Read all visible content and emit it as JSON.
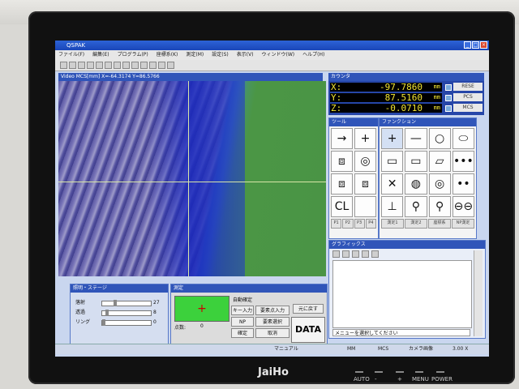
{
  "device": {
    "brand": "JaiHo",
    "buttons": [
      "AUTO",
      "-",
      "+",
      "MENU",
      "POWER"
    ]
  },
  "window": {
    "title": "QSPAK",
    "menu": [
      "ファイル(F)",
      "編集(E)",
      "プログラム(P)",
      "座標系(K)",
      "測定(M)",
      "設定(S)",
      "表示(V)",
      "ウィンドウ(W)",
      "ヘルプ(H)"
    ]
  },
  "video": {
    "title": "Video   MCS[mm] X=-64.3174 Y=86.5766"
  },
  "counter": {
    "title": "カウンタ",
    "rows": [
      {
        "axis": "X:",
        "value": "-97.7860",
        "unit": "mm",
        "label": "RESE"
      },
      {
        "axis": "Y:",
        "value": "87.5160",
        "unit": "mm",
        "label": "PCS"
      },
      {
        "axis": "Z:",
        "value": "-0.0710",
        "unit": "mm",
        "label": "MCS"
      }
    ]
  },
  "tools": {
    "title": "ツール",
    "items": [
      "→",
      "+",
      "⧈",
      "◎",
      "⧈",
      "⧈",
      "CL",
      ""
    ],
    "tabs": [
      "P1",
      "P2",
      "P3",
      "P4"
    ]
  },
  "functions": {
    "title": "ファンクション",
    "items": [
      "+",
      "—",
      "○",
      "⬭",
      "▭",
      "▭",
      "▱",
      "•••",
      "✕",
      "◍",
      "◎",
      "••",
      "⊥",
      "⚲",
      "⚲",
      "⊖⊖"
    ],
    "tabs": [
      "測定1",
      "測定2",
      "座標系",
      "NP測定"
    ]
  },
  "graphics": {
    "title": "グラフィックス",
    "status": "メニューを選択してください"
  },
  "lighting": {
    "title": "照明・ステージ",
    "rows": [
      {
        "label": "落射",
        "value": "27"
      },
      {
        "label": "透過",
        "value": "8"
      },
      {
        "label": "リング",
        "value": "0"
      }
    ],
    "unit": "%"
  },
  "measure": {
    "title": "測定",
    "auto_check": "自動確定",
    "buttons": {
      "key_input": "キー入力",
      "add_point": "要素点入力",
      "back": "元に戻す",
      "np": "NP",
      "select": "要素選択",
      "data": "DATA",
      "confirm": "確定",
      "cancel": "取消"
    },
    "points_label": "点数:",
    "points_value": "0"
  },
  "status_bar": {
    "items": [
      "マニュアル",
      "MM",
      "MCS",
      "カメラ画像",
      "3.00 X"
    ]
  }
}
